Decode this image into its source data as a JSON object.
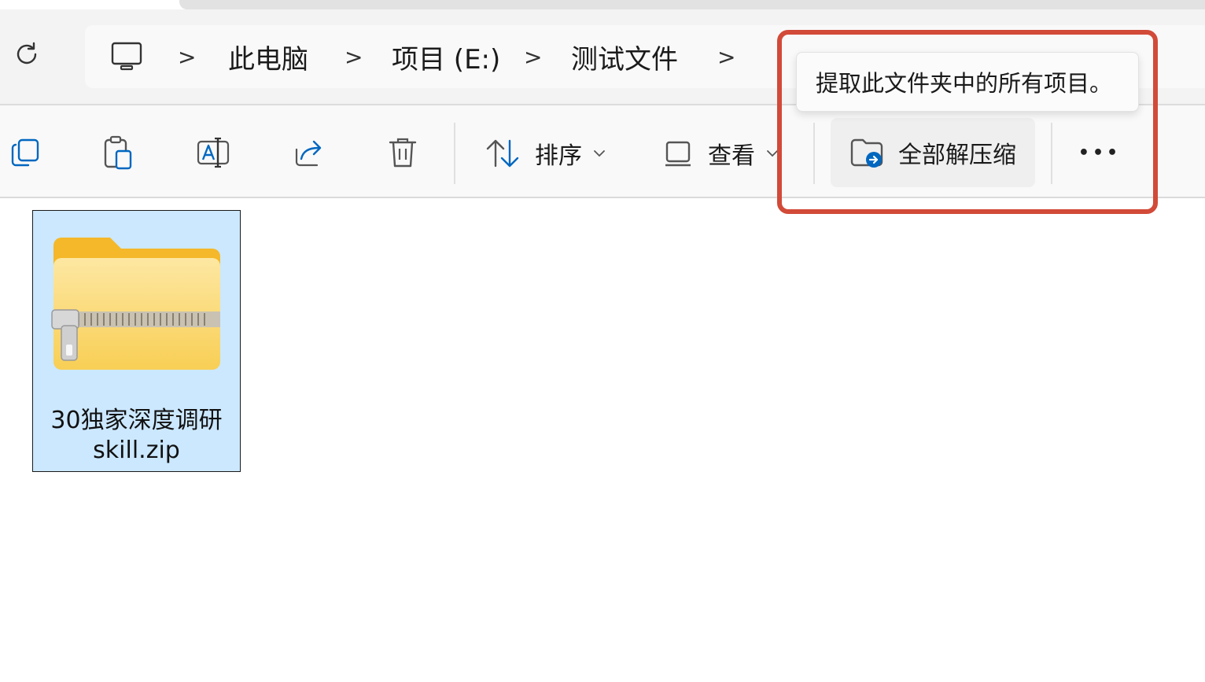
{
  "breadcrumb": {
    "items": [
      "此电脑",
      "项目 (E:)",
      "测试文件"
    ],
    "separator": ">"
  },
  "toolbar": {
    "sort_label": "排序",
    "view_label": "查看",
    "extract_all_label": "全部解压缩",
    "more_label": "•••"
  },
  "tooltip": {
    "text": "提取此文件夹中的所有项目。"
  },
  "files": [
    {
      "name": "30独家深度调研skill.zip",
      "selected": true,
      "icon": "zip-folder-icon"
    }
  ],
  "colors": {
    "highlight": "#d24a38",
    "selection": "#cce8ff",
    "folder": "#f7c948",
    "accent": "#0067c0"
  }
}
